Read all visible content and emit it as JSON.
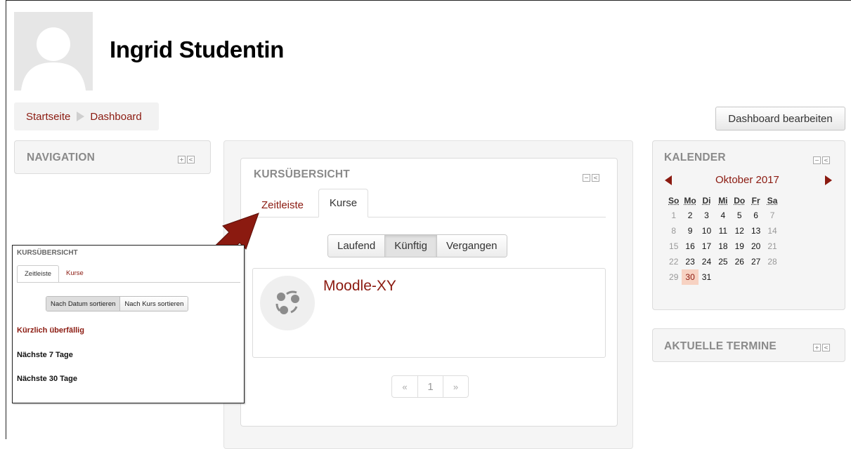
{
  "user": {
    "name": "Ingrid Studentin"
  },
  "breadcrumb": {
    "home": "Startseite",
    "current": "Dashboard"
  },
  "header": {
    "edit_button": "Dashboard bearbeiten"
  },
  "navigation_block": {
    "title": "NAVIGATION"
  },
  "course_overview": {
    "title": "KURSÜBERSICHT",
    "tabs": [
      "Zeitleiste",
      "Kurse"
    ],
    "active_tab": "Kurse",
    "filter_buttons": [
      "Laufend",
      "Künftig",
      "Vergangen"
    ],
    "active_filter": "Künftig",
    "course": {
      "name": "Moodle-XY"
    },
    "pagination": {
      "prev": "«",
      "page": "1",
      "next": "»"
    }
  },
  "calendar": {
    "title": "KALENDER",
    "month": "Oktober 2017",
    "weekdays": [
      "So",
      "Mo",
      "Di",
      "Mi",
      "Do",
      "Fr",
      "Sa"
    ],
    "weeks": [
      [
        "1",
        "2",
        "3",
        "4",
        "5",
        "6",
        "7"
      ],
      [
        "8",
        "9",
        "10",
        "11",
        "12",
        "13",
        "14"
      ],
      [
        "15",
        "16",
        "17",
        "18",
        "19",
        "20",
        "21"
      ],
      [
        "22",
        "23",
        "24",
        "25",
        "26",
        "27",
        "28"
      ],
      [
        "29",
        "30",
        "31",
        "",
        "",
        "",
        ""
      ]
    ],
    "today": "30"
  },
  "upcoming_block": {
    "title": "AKTUELLE TERMINE"
  },
  "inset": {
    "title": "KURSÜBERSICHT",
    "tabs": [
      "Zeitleiste",
      "Kurse"
    ],
    "sort_buttons": [
      "Nach Datum sortieren",
      "Nach Kurs sortieren"
    ],
    "overdue": "Kürzlich überfällig",
    "next7": "Nächste 7 Tage",
    "next30": "Nächste 30 Tage"
  },
  "colors": {
    "accent": "#8b1a10",
    "today_bg": "#f7d2c2",
    "arrow": "#8b1a10"
  }
}
